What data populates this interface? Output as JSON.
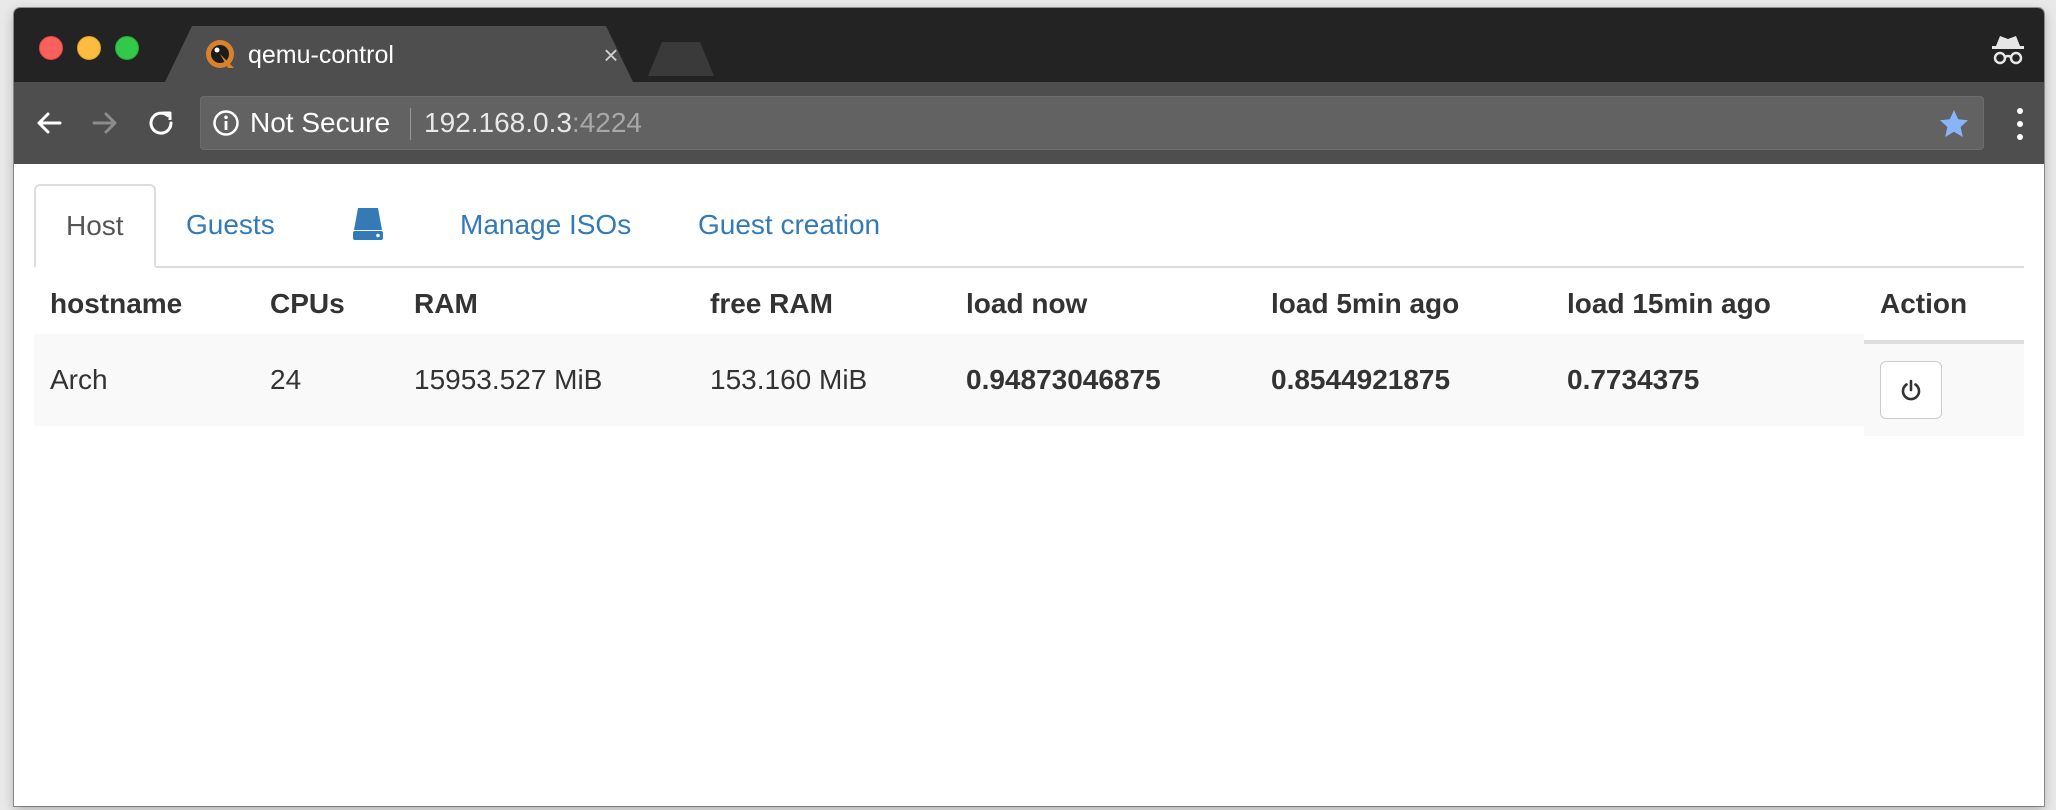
{
  "browser": {
    "tab": {
      "title": "qemu-control",
      "close_glyph": "×"
    },
    "toolbar": {
      "security_label": "Not Secure",
      "url_host": "192.168.0.3",
      "url_port": ":4224"
    },
    "icons": {
      "back": "arrow-left-icon",
      "forward": "arrow-right-icon",
      "reload": "reload-icon",
      "info": "info-icon",
      "bookmark": "star-icon",
      "menu": "kebab-menu-icon",
      "incognito": "incognito-icon"
    },
    "colors": {
      "star": "#8ab4f8",
      "chrome_dark": "#232323",
      "toolbar": "#4e4e4e"
    }
  },
  "page": {
    "tabs": [
      {
        "label": "Host",
        "active": true
      },
      {
        "label": "Guests",
        "active": false
      },
      {
        "label": "",
        "icon": "drive-icon",
        "active": false
      },
      {
        "label": "Manage ISOs",
        "active": false
      },
      {
        "label": "Guest creation",
        "active": false
      }
    ],
    "table": {
      "headers": [
        "hostname",
        "CPUs",
        "RAM",
        "free RAM",
        "load now",
        "load 5min ago",
        "load 15min ago",
        "Action"
      ],
      "rows": [
        {
          "hostname": "Arch",
          "cpus": "24",
          "ram": "15953.527 MiB",
          "free_ram": "153.160 MiB",
          "load_now": "0.94873046875",
          "load_5min": "0.8544921875",
          "load_15min": "0.7734375",
          "action_icon": "power-icon"
        }
      ]
    },
    "colors": {
      "link": "#337ab7",
      "text": "#333333"
    }
  }
}
